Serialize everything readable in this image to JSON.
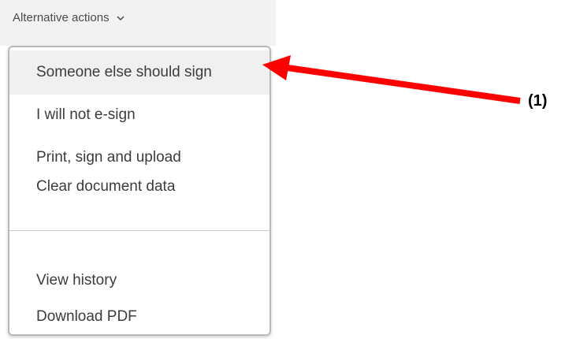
{
  "header": {
    "trigger_label": "Alternative actions",
    "trigger_icon": "chevron-down-icon"
  },
  "menu": {
    "items": [
      {
        "label": "Someone else should sign",
        "highlighted": true
      },
      {
        "label": "I will not e-sign"
      },
      {
        "label": "Print, sign and upload"
      },
      {
        "label": "Clear document data"
      }
    ],
    "secondary_items": [
      {
        "label": "View history"
      },
      {
        "label": "Download PDF"
      }
    ]
  },
  "annotation": {
    "label": "(1)",
    "arrow_color": "#ff0000"
  }
}
